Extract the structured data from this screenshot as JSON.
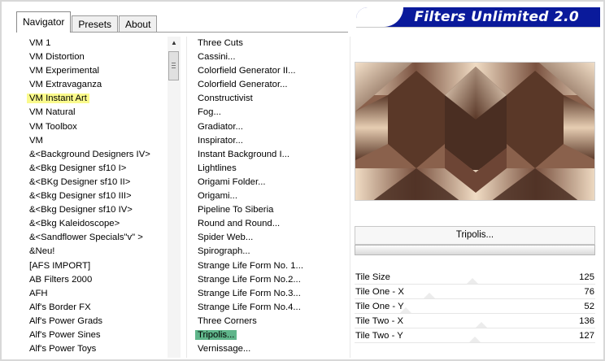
{
  "app": {
    "title": "Filters Unlimited 2.0"
  },
  "tabs": [
    {
      "label": "Navigator",
      "active": true
    },
    {
      "label": "Presets",
      "active": false
    },
    {
      "label": "About",
      "active": false
    }
  ],
  "categories": [
    "VM 1",
    "VM Distortion",
    "VM Experimental",
    "VM Extravaganza",
    "VM Instant Art",
    "VM Natural",
    "VM Toolbox",
    "VM",
    "&<Background Designers IV>",
    "&<Bkg Designer sf10 I>",
    "&<BKg Designer sf10 II>",
    "&<Bkg Designer sf10 III>",
    "&<Bkg Designer sf10 IV>",
    "&<Bkg Kaleidoscope>",
    "&<Sandflower Specials\"v\" >",
    "&Neu!",
    "[AFS IMPORT]",
    "AB Filters 2000",
    "AFH",
    "Alf's Border FX",
    "Alf's Power Grads",
    "Alf's Power Sines",
    "Alf's Power Toys"
  ],
  "selected_category": "VM Instant Art",
  "filters": [
    "Three Cuts",
    "Cassini...",
    "Colorfield Generator II...",
    "Colorfield Generator...",
    "Constructivist",
    "Fog...",
    "Gradiator...",
    "Inspirator...",
    "Instant Background I...",
    "Lightlines",
    "Origami Folder...",
    "Origami...",
    "Pipeline To Siberia",
    "Round and Round...",
    "Spider Web...",
    "Spirograph...",
    "Strange Life Form No. 1...",
    "Strange Life Form No.2...",
    "Strange Life Form No.3...",
    "Strange Life Form No.4...",
    "Three Corners",
    "Tripolis...",
    "Vernissage..."
  ],
  "selected_filter": "Tripolis...",
  "current_filter_label": "Tripolis...",
  "params": [
    {
      "label": "Tile Size",
      "value": "125",
      "level": 0.49
    },
    {
      "label": "Tile One - X",
      "value": "76",
      "level": 0.3
    },
    {
      "label": "Tile One - Y",
      "value": "52",
      "level": 0.2
    },
    {
      "label": "Tile Two - X",
      "value": "136",
      "level": 0.53
    },
    {
      "label": "Tile Two - Y",
      "value": "127",
      "level": 0.5
    }
  ],
  "colors": {
    "banner": "#0a1a9b",
    "highlight_category": "#fafa8c",
    "highlight_filter": "#5fb58a",
    "preview_dark": "#4a2e22",
    "preview_light": "#f0dcc4"
  },
  "icons": {
    "scroll_up": "scroll-up-arrow-icon"
  }
}
